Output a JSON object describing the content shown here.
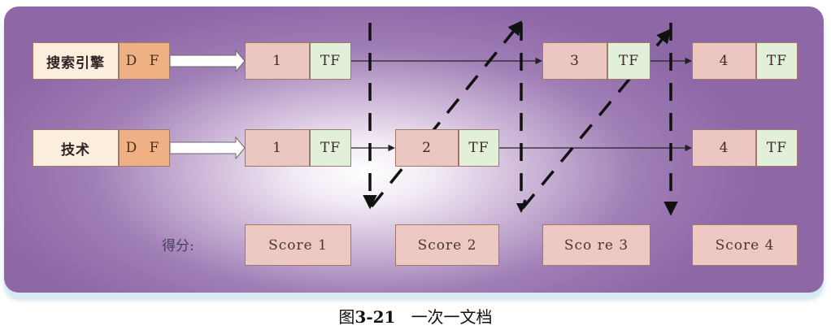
{
  "terms": [
    {
      "term": "搜索引擎",
      "df": "D F"
    },
    {
      "term": "技术",
      "df": "D F"
    }
  ],
  "postings": {
    "row1": [
      {
        "doc": "1",
        "tf": "TF"
      },
      {
        "doc": "3",
        "tf": "TF"
      },
      {
        "doc": "4",
        "tf": "TF"
      }
    ],
    "row2": [
      {
        "doc": "1",
        "tf": "TF"
      },
      {
        "doc": "2",
        "tf": "TF"
      },
      {
        "doc": "4",
        "tf": "TF"
      }
    ]
  },
  "score_label": "得分:",
  "scores": [
    "Score 1",
    "Score 2",
    "Sco re 3",
    "Score 4"
  ],
  "caption": {
    "prefix": "图",
    "number": "3-21",
    "text": "一次一文档"
  },
  "colors": {
    "df_fill": "#efb183",
    "doc_fill": "#ecc6c0",
    "tf_fill": "#e2efd9",
    "term_fill": "#fbeedd",
    "score_fill": "#eec8c2",
    "panel_edge": "#8d67a6"
  }
}
